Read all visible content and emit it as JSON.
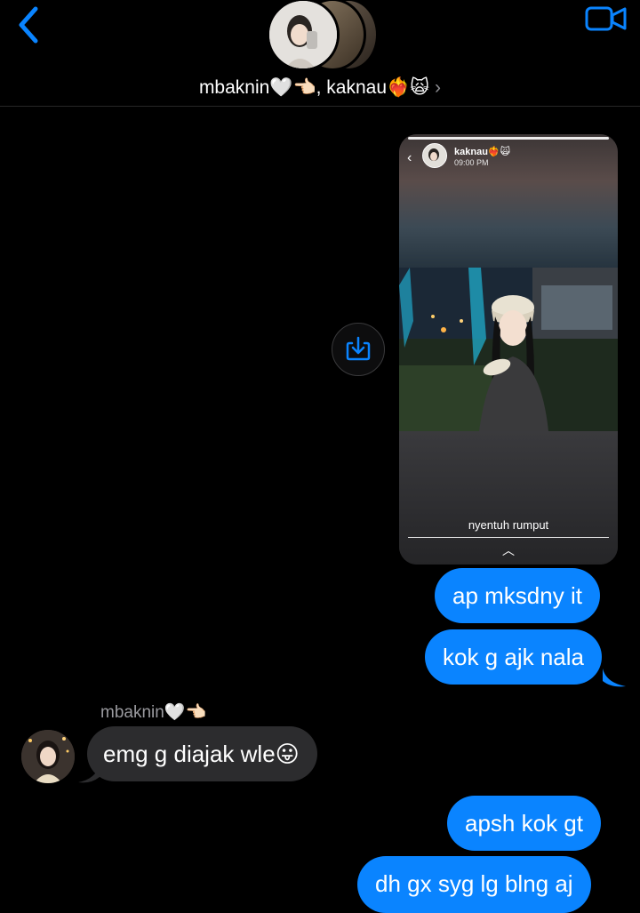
{
  "header": {
    "group_name": "mbaknin🤍👈🏻, kaknau❤️‍🔥🙀",
    "chevron": "›",
    "icons": {
      "back": "chevron-left-icon",
      "video": "video-call-icon"
    },
    "accent": "#0a84ff"
  },
  "story": {
    "username": "kaknau❤️‍🔥🙀",
    "time": "09:00 PM",
    "caption": "nyentuh rumput",
    "back": "‹",
    "expand": "︿"
  },
  "messages": [
    {
      "from": "me",
      "text": "ap mksdny it"
    },
    {
      "from": "me",
      "text": "kok g ajk nala"
    },
    {
      "from": "them",
      "sender": "mbaknin🤍👈🏻",
      "text": "emg g diajak wle😛"
    },
    {
      "from": "me",
      "text": "apsh kok gt"
    },
    {
      "from": "me",
      "text": "dh gx syg lg blng aj"
    }
  ]
}
